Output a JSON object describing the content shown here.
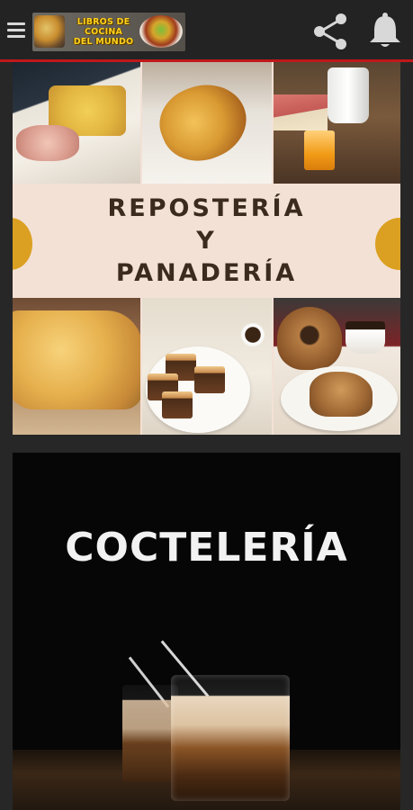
{
  "appbar": {
    "logo_lines": [
      "LIBROS DE",
      "COCINA",
      "DEL MUNDO"
    ],
    "menu_icon": "hamburger-menu-icon",
    "share_icon": "share-icon",
    "bell_icon": "notification-bell-icon",
    "accent_color": "#c0181b"
  },
  "cards": [
    {
      "title_lines": [
        "REPOSTERÍA",
        "Y",
        "PANADERÍA"
      ],
      "background": "#f3e1d6",
      "accent": "#dba021"
    },
    {
      "title": "COCTELERÍA",
      "background": "#060606"
    }
  ]
}
